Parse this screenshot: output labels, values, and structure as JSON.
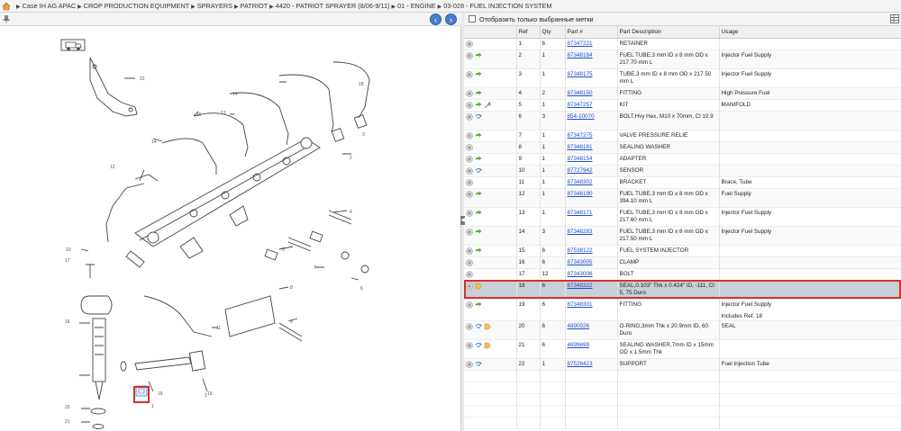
{
  "breadcrumb": [
    "Case IH AG APAC",
    "CROP PRODUCTION EQUIPMENT",
    "SPRAYERS",
    "PATRIOT",
    "4420 - PATRIOT SPRAYER (8/06-9/11)",
    "01 - ENGINE",
    "03-028 - FUEL INJECTION SYSTEM"
  ],
  "filter": {
    "label": "Отобразить только выбранные метки",
    "checked": false
  },
  "columns": {
    "ref": "Ref",
    "qty": "Qty",
    "part": "Part #",
    "desc": "Part Description",
    "usage": "Usage"
  },
  "rows": [
    {
      "ref": "1",
      "qty": "6",
      "part": "87347221",
      "desc": "RETAINER",
      "usage": "",
      "icons": [
        "add"
      ]
    },
    {
      "ref": "2",
      "qty": "1",
      "part": "87348184",
      "desc": "FUEL TUBE,3 mm ID x 8 mm OD x 217.70 mm L",
      "usage": "Injector Fuel Supply",
      "icons": [
        "add",
        "arrow"
      ]
    },
    {
      "ref": "3",
      "qty": "1",
      "part": "87348175",
      "desc": "TUBE,3 mm ID x 8 mm OD x 217.50 mm L",
      "usage": "Injector Fuel Supply",
      "icons": [
        "add",
        "arrow"
      ]
    },
    {
      "ref": "4",
      "qty": "2",
      "part": "87348150",
      "desc": "FITTING",
      "usage": "High Pressure Fuel",
      "icons": [
        "add",
        "arrow"
      ]
    },
    {
      "ref": "5",
      "qty": "1",
      "part": "87347257",
      "desc": "KIT",
      "usage": "MANIFOLD",
      "icons": [
        "add",
        "arrow",
        "wrench"
      ]
    },
    {
      "ref": "6",
      "qty": "3",
      "part": "854-10070",
      "desc": "BOLT,Hvy Hex, M10 x 70mm, Cl 10.9",
      "usage": "",
      "icons": [
        "add",
        "swap"
      ]
    },
    {
      "ref": "7",
      "qty": "1",
      "part": "87347275",
      "desc": "VALVE PRESSURE RELIE",
      "usage": "",
      "icons": [
        "add",
        "arrow"
      ]
    },
    {
      "ref": "8",
      "qty": "1",
      "part": "87348161",
      "desc": "SEALING WASHER",
      "usage": "",
      "icons": [
        "add"
      ]
    },
    {
      "ref": "9",
      "qty": "1",
      "part": "87348154",
      "desc": "ADAPTER",
      "usage": "",
      "icons": [
        "add",
        "arrow"
      ]
    },
    {
      "ref": "10",
      "qty": "1",
      "part": "87727942",
      "desc": "SENSOR",
      "usage": "",
      "icons": [
        "add",
        "swap"
      ]
    },
    {
      "ref": "11",
      "qty": "1",
      "part": "87348302",
      "desc": "BRACKET",
      "usage": "Brace, Tube",
      "icons": [
        "add"
      ]
    },
    {
      "ref": "12",
      "qty": "1",
      "part": "87348190",
      "desc": "FUEL TUBE,3 mm ID x 8 mm OD x 394.10 mm L",
      "usage": "Fuel Supply",
      "icons": [
        "add",
        "arrow"
      ]
    },
    {
      "ref": "13",
      "qty": "1",
      "part": "87348171",
      "desc": "FUEL TUBE,3 mm ID x 8 mm OD x 217.60 mm L",
      "usage": "Injector Fuel Supply",
      "icons": [
        "add",
        "arrow"
      ]
    },
    {
      "ref": "14",
      "qty": "3",
      "part": "87348283",
      "desc": "FUEL TUBE,3 mm ID x 8 mm OD x 217.50 mm L",
      "usage": "Injector Fuel Supply",
      "icons": [
        "add",
        "arrow"
      ]
    },
    {
      "ref": "15",
      "qty": "6",
      "part": "87538122",
      "desc": "FUEL SYSTEM INJECTOR",
      "usage": "",
      "icons": [
        "add",
        "arrow"
      ]
    },
    {
      "ref": "16",
      "qty": "6",
      "part": "87343005",
      "desc": "CLAMP",
      "usage": "",
      "icons": [
        "add"
      ]
    },
    {
      "ref": "17",
      "qty": "12",
      "part": "87343006",
      "desc": "BOLT",
      "usage": "",
      "icons": [
        "add"
      ]
    },
    {
      "ref": "18",
      "qty": "6",
      "part": "87348322",
      "desc": "SEAL,0.103\" Thk x 0.424\" ID, -111, Cl 5, 75 Duro",
      "usage": "",
      "icons": [
        "add",
        "tag"
      ],
      "selected": true
    },
    {
      "ref": "19",
      "qty": "6",
      "part": "87348301",
      "desc": "FITTING",
      "usage": "Injector Fuel Supply",
      "icons": [
        "add",
        "arrow"
      ],
      "extra_usage": "Includes Ref. 18"
    },
    {
      "ref": "20",
      "qty": "6",
      "part": "4890926",
      "desc": "O-RING,3mm Thk x 20.9mm ID, 60 Duro",
      "usage": "SEAL",
      "icons": [
        "add",
        "swap",
        "tag"
      ]
    },
    {
      "ref": "21",
      "qty": "6",
      "part": "4899699",
      "desc": "SEALING WASHER,7mm ID x 15mm OD x 1.5mm Thk",
      "usage": "",
      "icons": [
        "add",
        "swap",
        "tag"
      ]
    },
    {
      "ref": "22",
      "qty": "1",
      "part": "87526423",
      "desc": "SUPPORT",
      "usage": "Fuel Injection Tube",
      "icons": [
        "add",
        "swap"
      ]
    }
  ],
  "diagram": {
    "labels": [
      "22",
      "15",
      "14",
      "14",
      "13",
      "12",
      "2",
      "3",
      "4",
      "5",
      "6",
      "7",
      "8",
      "9",
      "10",
      "11",
      "16",
      "17",
      "18",
      "19",
      "20",
      "21",
      "1",
      "1",
      "18"
    ]
  },
  "colors": {
    "accent": "#4a7fc9",
    "link": "#1a4fd0",
    "selected_bg": "#c9cfd6",
    "highlight": "#d43131",
    "arrow": "#5aab3a"
  }
}
